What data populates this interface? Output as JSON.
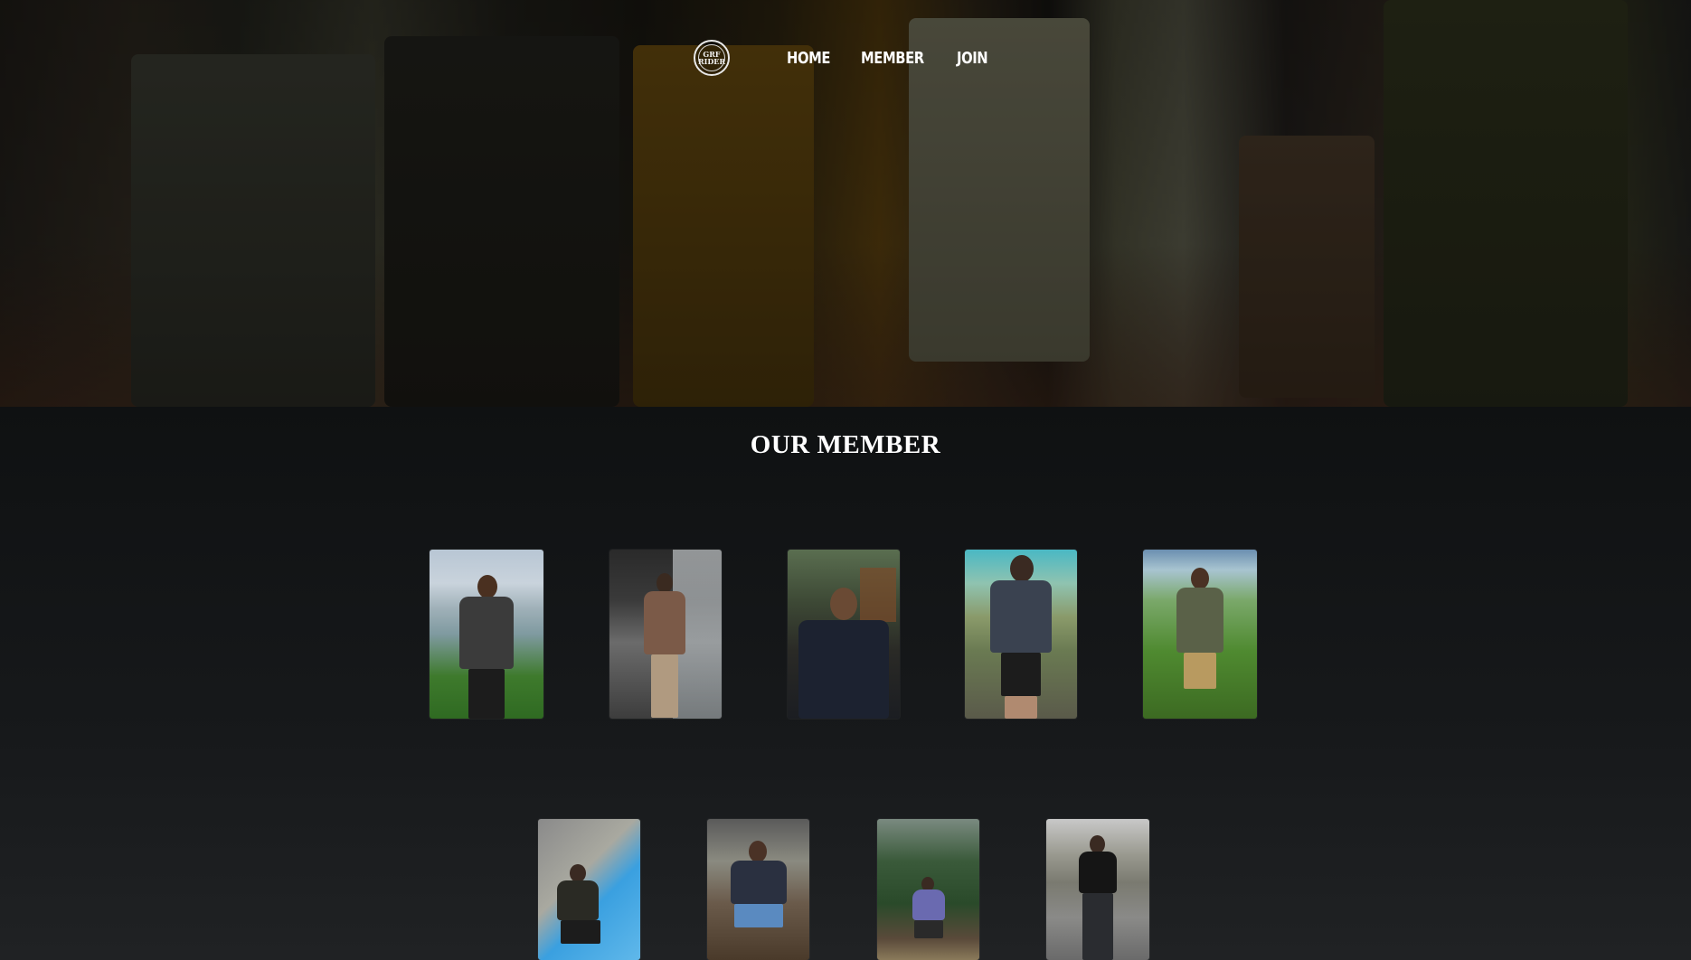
{
  "nav": {
    "logo_text": "GRF\nRIDER",
    "links": [
      "HOME",
      "MEMBER",
      "JOIN"
    ]
  },
  "members_section": {
    "title": "OUR MEMBER"
  },
  "members_row1": [
    {
      "photo": "member-photo-1"
    },
    {
      "photo": "member-photo-2"
    },
    {
      "photo": "member-photo-3"
    },
    {
      "photo": "member-photo-4"
    },
    {
      "photo": "member-photo-5"
    }
  ],
  "members_row2": [
    {
      "photo": "member-photo-6"
    },
    {
      "photo": "member-photo-7"
    },
    {
      "photo": "member-photo-8"
    },
    {
      "photo": "member-photo-9"
    }
  ],
  "colors": {
    "page_bg": "#111314",
    "text": "#ffffff"
  }
}
